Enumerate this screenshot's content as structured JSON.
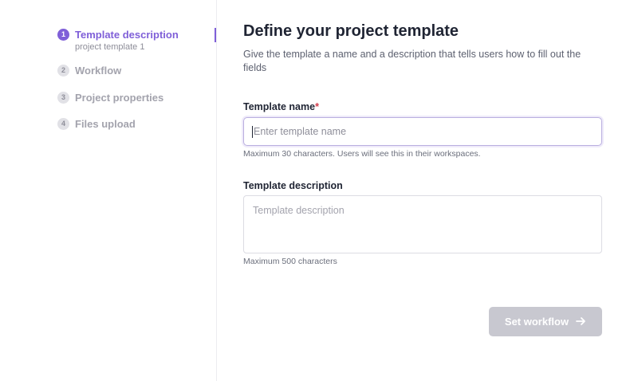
{
  "steps": [
    {
      "number": "1",
      "label": "Template description",
      "sub": "project template 1"
    },
    {
      "number": "2",
      "label": "Workflow"
    },
    {
      "number": "3",
      "label": "Project properties"
    },
    {
      "number": "4",
      "label": "Files upload"
    }
  ],
  "header": {
    "title": "Define your project template",
    "description": "Give the template a name and a description that tells users how to fill out the fields"
  },
  "form": {
    "name_label": "Template name",
    "name_required_mark": "*",
    "name_placeholder": "Enter template name",
    "name_value": "",
    "name_hint": "Maximum 30 characters. Users will see this in their workspaces.",
    "desc_label": "Template description",
    "desc_placeholder": "Template description",
    "desc_value": "",
    "desc_hint": "Maximum 500 characters"
  },
  "actions": {
    "next_label": "Set workflow",
    "next_icon": "arrow-right-icon"
  },
  "colors": {
    "accent": "#7f5fd8",
    "disabled_button": "#c8c8d0",
    "required": "#d23b4b"
  }
}
